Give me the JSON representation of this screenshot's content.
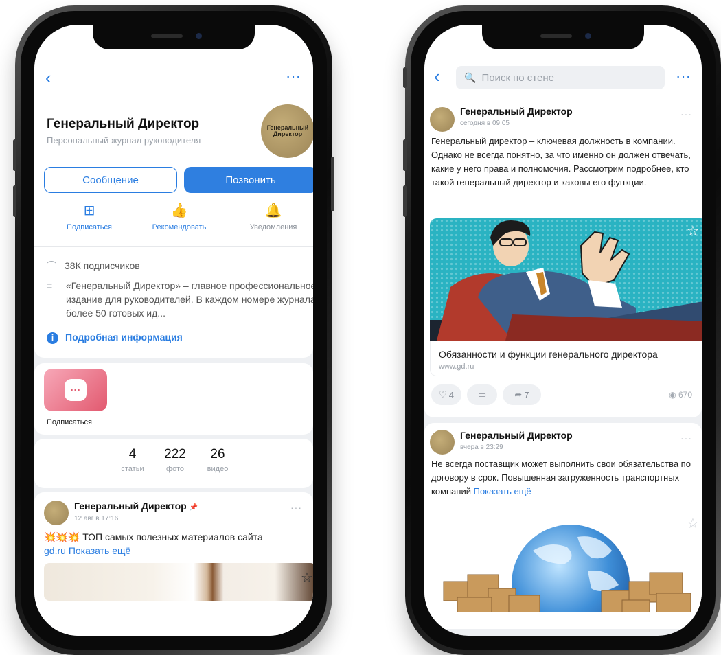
{
  "left_screen": {
    "header": {
      "back_icon": "chevron-left-icon",
      "more_icon": "ellipsis-icon"
    },
    "profile": {
      "name": "Генеральный Директор",
      "subtitle": "Персональный журнал руководителя",
      "avatar_text": "Генеральный Директор"
    },
    "buttons": {
      "message": "Сообщение",
      "call": "Позвонить"
    },
    "actions": [
      {
        "label": "Подписаться",
        "icon": "plus-square-icon",
        "color": "#2a7de1"
      },
      {
        "label": "Рекомендовать",
        "icon": "thumbs-up-icon",
        "color": "#2a7de1"
      },
      {
        "label": "Уведомления",
        "icon": "bell-icon",
        "color": "#8a9099"
      }
    ],
    "info": {
      "subscribers": "38К подписчиков",
      "description": "«Генеральный Директор» – главное профессиональное издание для руководителей. В каждом номере журнала более 50 готовых ид...",
      "more_info": "Подробная информация"
    },
    "subscribe_widget": {
      "label": "Подписаться",
      "bubble": "···"
    },
    "stats": [
      {
        "number": "4",
        "label": "статьи"
      },
      {
        "number": "222",
        "label": "фото"
      },
      {
        "number": "26",
        "label": "видео"
      }
    ],
    "post": {
      "author": "Генеральный Директор",
      "pin": "📌",
      "date": "12 авг в 17:16",
      "emoji": "💥💥💥",
      "text": "ТОП самых полезных материалов сайта",
      "link": "gd.ru",
      "show_more": "Показать ещё",
      "dots": "···",
      "star_icon": "star-icon"
    }
  },
  "right_screen": {
    "header": {
      "back_icon": "chevron-left-icon",
      "search_placeholder": "Поиск по стене",
      "more_icon": "ellipsis-icon"
    },
    "post1": {
      "author": "Генеральный Директор",
      "date": "сегодня в 09:05",
      "text": "Генеральный директор – ключевая должность в компании. Однако не всегда понятно, за что именно он должен отвечать, какие у него права и полномочия. Рассмотрим подробнее, кто такой генеральный директор и каковы его функции.",
      "link_title": "Обязанности и функции генерального директора",
      "link_url": "www.gd.ru",
      "likes": "4",
      "reposts": "7",
      "views": "670",
      "dots": "···"
    },
    "post2": {
      "author": "Генеральный Директор",
      "date": "вчера в 23:29",
      "text": "Не всегда поставщик может выполнить свои обязательства по договору в срок. Повышенная загруженность транспортных компаний",
      "show_more": "Показать ещё",
      "dots": "···"
    }
  },
  "colors": {
    "accent": "#2a7de1",
    "phone_frame": "#0a0a0a",
    "illustration_teal": "#2ab3c2",
    "subscribe_pink": "#e2596f"
  }
}
